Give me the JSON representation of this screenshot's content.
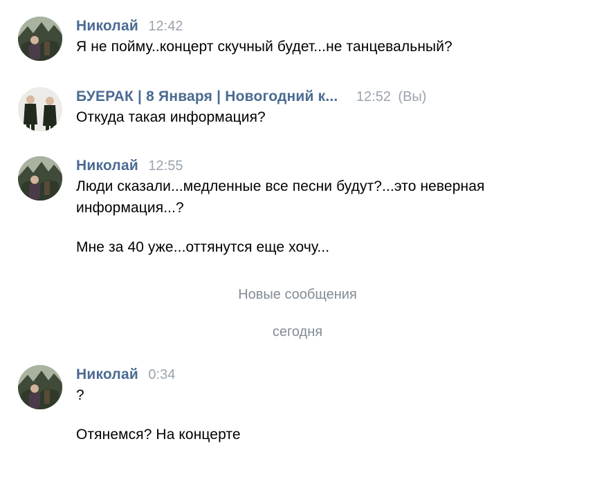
{
  "messages": [
    {
      "author": "Николай",
      "time": "12:42",
      "paragraphs": [
        "Я не пойму..концерт скучный будет...не танцевальный?"
      ]
    },
    {
      "author": "БУЕРАК | 8 Января | Новогодний к...",
      "time": "12:52",
      "you_label": "(Вы)",
      "paragraphs": [
        "Откуда такая информация?"
      ]
    },
    {
      "author": "Николай",
      "time": "12:55",
      "paragraphs": [
        "Люди сказали...медленные все песни будут?...это неверная информация...?",
        "Мне за 40 уже...оттянутся еще хочу..."
      ]
    },
    {
      "author": "Николай",
      "time": "0:34",
      "paragraphs": [
        "?",
        "Отянемся? На концерте"
      ]
    }
  ],
  "dividers": {
    "new_messages": "Новые сообщения",
    "today": "сегодня"
  },
  "colors": {
    "author": "#4a6a91",
    "time": "#9aa3ad",
    "divider": "#828b95",
    "text": "#000000"
  }
}
